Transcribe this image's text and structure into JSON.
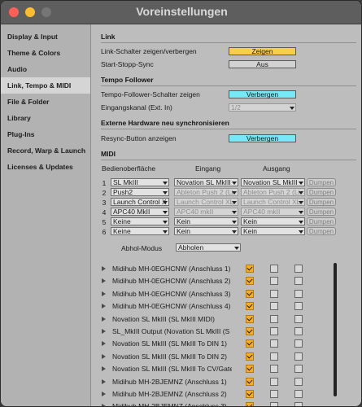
{
  "window": {
    "title": "Voreinstellungen"
  },
  "sidebar": {
    "items": [
      {
        "label": "Display & Input"
      },
      {
        "label": "Theme & Colors"
      },
      {
        "label": "Audio"
      },
      {
        "label": "Link, Tempo & MIDI"
      },
      {
        "label": "File & Folder"
      },
      {
        "label": "Library"
      },
      {
        "label": "Plug-Ins"
      },
      {
        "label": "Record, Warp & Launch"
      },
      {
        "label": "Licenses & Updates"
      }
    ],
    "active_index": 3
  },
  "link": {
    "header": "Link",
    "show_label": "Link-Schalter zeigen/verbergen",
    "show_button": "Zeigen",
    "sync_label": "Start-Stopp-Sync",
    "sync_button": "Aus"
  },
  "tempo": {
    "header": "Tempo Follower",
    "show_label": "Tempo-Follower-Schalter zeigen",
    "show_button": "Verbergen",
    "input_label": "Eingangskanal (Ext. In)",
    "input_value": "1/2"
  },
  "ext_hw": {
    "header": "Externe Hardware neu synchronisieren",
    "resync_label": "Resync-Button anzeigen",
    "resync_button": "Verbergen"
  },
  "midi": {
    "header": "MIDI",
    "col_surface": "Bedienoberfläche",
    "col_input": "Eingang",
    "col_output": "Ausgang",
    "dump_label": "Dumpen",
    "rows": [
      {
        "num": "1",
        "surface": "SL MkIII",
        "input": "Novation SL MkIII",
        "output": "Novation SL MkIII",
        "disabled": false
      },
      {
        "num": "2",
        "surface": "Push2",
        "input": "Ableton Push 2 (Li",
        "output": "Ableton Push 2 (Li",
        "disabled": true
      },
      {
        "num": "3",
        "surface": "Launch Control X",
        "input": "Launch Control XL",
        "output": "Launch Control XL",
        "disabled": true
      },
      {
        "num": "4",
        "surface": "APC40 MkII",
        "input": "APC40 mkII",
        "output": "APC40 mkII",
        "disabled": true
      },
      {
        "num": "5",
        "surface": "Keine",
        "input": "Kein",
        "output": "Kein",
        "disabled": false
      },
      {
        "num": "6",
        "surface": "Keine",
        "input": "Kein",
        "output": "Kein",
        "disabled": false
      }
    ],
    "takeover_label": "Abhol-Modus",
    "takeover_value": "Abholen"
  },
  "ports": [
    {
      "name": "Midihub MH-0EGHCNW (Anschluss 1)",
      "checks": [
        true,
        false,
        false
      ]
    },
    {
      "name": "Midihub MH-0EGHCNW (Anschluss 2)",
      "checks": [
        true,
        false,
        false
      ]
    },
    {
      "name": "Midihub MH-0EGHCNW (Anschluss 3)",
      "checks": [
        true,
        false,
        false
      ]
    },
    {
      "name": "Midihub MH-0EGHCNW (Anschluss 4)",
      "checks": [
        true,
        false,
        false
      ]
    },
    {
      "name": "Novation SL MkIII (SL MkIII MIDI)",
      "checks": [
        true,
        false,
        false
      ]
    },
    {
      "name": "SL_MkIII Output (Novation SL MkIII (S",
      "checks": [
        true,
        false,
        false
      ]
    },
    {
      "name": "Novation SL MkIII (SL MkIII To DIN 1)",
      "checks": [
        true,
        false,
        false
      ]
    },
    {
      "name": "Novation SL MkIII (SL MkIII To DIN 2)",
      "checks": [
        true,
        false,
        false
      ]
    },
    {
      "name": "Novation SL MkIII (SL MkIII To CV/Gate",
      "checks": [
        true,
        false,
        false
      ]
    },
    {
      "name": "Midihub MH-2BJEMNZ (Anschluss 1)",
      "checks": [
        true,
        false,
        false
      ]
    },
    {
      "name": "Midihub MH-2BJEMNZ (Anschluss 2)",
      "checks": [
        true,
        false,
        false
      ]
    },
    {
      "name": "Midihub MH-2BJEMNZ (Anschluss 3)",
      "checks": [
        true,
        false,
        false
      ]
    }
  ]
}
